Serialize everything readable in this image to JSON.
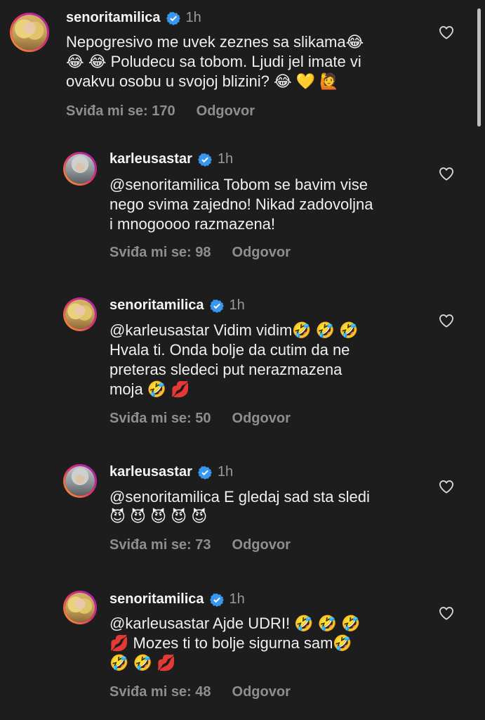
{
  "comments": [
    {
      "username": "senoritamilica",
      "verified": true,
      "time": "1h",
      "text": "Nepogresivo me uvek zeznes sa slikama😂\n😂 😂 Poludecu sa tobom. Ljudi jel imate vi\novakvu osobu u svojoj blizini? 😂 💛 🙋",
      "likes": "Sviđa mi se: 170",
      "reply": "Odgovor",
      "avatar": "senoritamilica-avatar"
    },
    {
      "username": "karleusastar",
      "verified": true,
      "time": "1h",
      "text": "@senoritamilica Tobom se bavim vise\nnego svima zajedno! Nikad zadovoljna\ni mnogoooo razmazena!",
      "likes": "Sviđa mi se: 98",
      "reply": "Odgovor",
      "avatar": "karleusastar-avatar"
    },
    {
      "username": "senoritamilica",
      "verified": true,
      "time": "1h",
      "text": "@karleusastar Vidim vidim🤣 🤣 🤣\nHvala ti. Onda bolje da cutim da ne\npreteras sledeci put nerazmazena\nmoja 🤣 💋",
      "likes": "Sviđa mi se: 50",
      "reply": "Odgovor",
      "avatar": "senoritamilica-avatar"
    },
    {
      "username": "karleusastar",
      "verified": true,
      "time": "1h",
      "text": "@senoritamilica E gledaj sad sta sledi\n😈 😈 😈 😈 😈",
      "likes": "Sviđa mi se: 73",
      "reply": "Odgovor",
      "avatar": "karleusastar-avatar"
    },
    {
      "username": "senoritamilica",
      "verified": true,
      "time": "1h",
      "text": "@karleusastar Ajde UDRI! 🤣 🤣 🤣\n💋 Mozes ti to bolje sigurna sam🤣\n🤣 🤣 💋",
      "likes": "Sviđa mi se: 48",
      "reply": "Odgovor",
      "avatar": "senoritamilica-avatar"
    }
  ],
  "colors": {
    "background": "#1d1d1d",
    "verified": "#3897f0",
    "meta": "#8e8e8e",
    "time": "#9a9a9a"
  },
  "icons": {
    "verified": "verified-badge-icon",
    "like": "heart-outline-icon"
  }
}
